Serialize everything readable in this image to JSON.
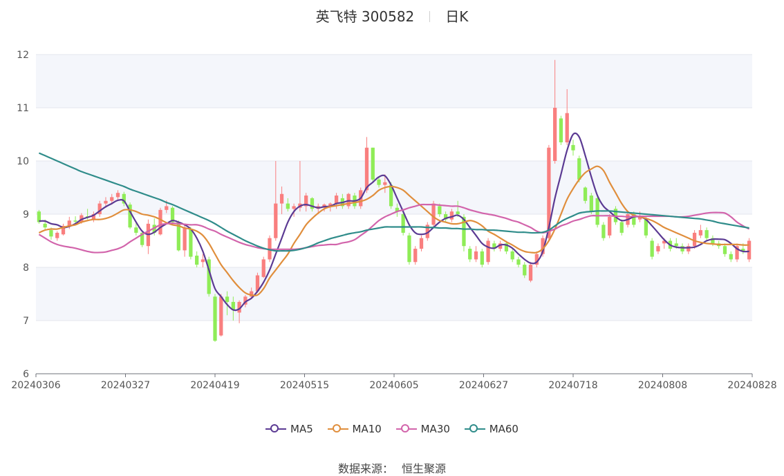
{
  "header": {
    "stock_label": "英飞特 300582",
    "period_label": "日K"
  },
  "legend": {
    "items": [
      {
        "label": "MA5",
        "color": "#5b3a93"
      },
      {
        "label": "MA10",
        "color": "#e08e3c"
      },
      {
        "label": "MA30",
        "color": "#d264ab"
      },
      {
        "label": "MA60",
        "color": "#2f8c8a"
      }
    ]
  },
  "footer": {
    "source_label": "数据来源：",
    "source_value": "恒生聚源"
  },
  "chart_data": {
    "type": "candlestick",
    "ylim": [
      6,
      12
    ],
    "y_ticks": [
      "6",
      "7",
      "8",
      "9",
      "10",
      "11",
      "12"
    ],
    "x_tick_labels": [
      "20240306",
      "20240327",
      "20240419",
      "20240515",
      "20240605",
      "20240627",
      "20240718",
      "20240808",
      "20240828"
    ],
    "up_color": "#f97f7f",
    "down_color": "#8fec57",
    "grid": "horizontal",
    "bands": true,
    "ohlc": [
      [
        9.05,
        9.08,
        8.82,
        8.85
      ],
      [
        8.82,
        8.9,
        8.7,
        8.75
      ],
      [
        8.7,
        8.75,
        8.52,
        8.58
      ],
      [
        8.55,
        8.68,
        8.5,
        8.65
      ],
      [
        8.62,
        8.82,
        8.6,
        8.78
      ],
      [
        8.78,
        8.95,
        8.72,
        8.88
      ],
      [
        8.88,
        8.96,
        8.8,
        8.86
      ],
      [
        8.85,
        9.02,
        8.82,
        8.98
      ],
      [
        8.96,
        9.1,
        8.9,
        8.93
      ],
      [
        8.9,
        9.05,
        8.85,
        9.0
      ],
      [
        9.0,
        9.25,
        8.95,
        9.2
      ],
      [
        9.2,
        9.32,
        9.12,
        9.25
      ],
      [
        9.25,
        9.38,
        9.18,
        9.32
      ],
      [
        9.32,
        9.45,
        9.26,
        9.4
      ],
      [
        9.38,
        9.42,
        9.15,
        9.2
      ],
      [
        9.18,
        9.22,
        8.72,
        8.75
      ],
      [
        8.75,
        8.85,
        8.6,
        8.65
      ],
      [
        8.65,
        8.7,
        8.38,
        8.42
      ],
      [
        8.4,
        8.9,
        8.25,
        8.82
      ],
      [
        8.8,
        8.92,
        8.6,
        8.65
      ],
      [
        8.62,
        9.12,
        8.6,
        9.08
      ],
      [
        9.08,
        9.26,
        9.02,
        9.15
      ],
      [
        9.12,
        9.15,
        8.8,
        8.85
      ],
      [
        8.85,
        8.88,
        8.3,
        8.32
      ],
      [
        8.32,
        8.8,
        8.2,
        8.75
      ],
      [
        8.72,
        8.76,
        8.15,
        8.2
      ],
      [
        8.22,
        8.3,
        8.0,
        8.05
      ],
      [
        8.1,
        8.25,
        8.0,
        8.15
      ],
      [
        8.15,
        8.2,
        7.45,
        7.5
      ],
      [
        7.45,
        7.5,
        6.6,
        6.62
      ],
      [
        6.72,
        7.5,
        6.7,
        7.45
      ],
      [
        7.45,
        7.55,
        7.1,
        7.35
      ],
      [
        7.35,
        7.45,
        7.0,
        7.2
      ],
      [
        7.15,
        7.38,
        6.95,
        7.35
      ],
      [
        7.3,
        7.48,
        7.25,
        7.45
      ],
      [
        7.45,
        7.62,
        7.4,
        7.55
      ],
      [
        7.55,
        7.9,
        7.52,
        7.85
      ],
      [
        7.82,
        8.2,
        7.8,
        8.15
      ],
      [
        8.15,
        8.6,
        8.1,
        8.55
      ],
      [
        8.55,
        10.0,
        8.5,
        9.2
      ],
      [
        9.2,
        9.52,
        9.0,
        9.38
      ],
      [
        9.2,
        9.3,
        9.05,
        9.1
      ],
      [
        9.1,
        9.2,
        8.95,
        9.15
      ],
      [
        9.12,
        10.0,
        9.05,
        9.2
      ],
      [
        9.15,
        9.4,
        9.05,
        9.35
      ],
      [
        9.3,
        9.32,
        9.05,
        9.1
      ],
      [
        9.1,
        9.2,
        9.0,
        9.15
      ],
      [
        9.12,
        9.2,
        9.05,
        9.18
      ],
      [
        9.15,
        9.22,
        9.05,
        9.2
      ],
      [
        9.2,
        9.4,
        9.1,
        9.35
      ],
      [
        9.3,
        9.38,
        9.1,
        9.15
      ],
      [
        9.15,
        9.4,
        9.1,
        9.38
      ],
      [
        9.35,
        9.4,
        9.1,
        9.15
      ],
      [
        9.15,
        9.5,
        9.1,
        9.45
      ],
      [
        9.45,
        10.45,
        9.4,
        10.25
      ],
      [
        10.25,
        10.25,
        9.6,
        9.65
      ],
      [
        9.65,
        9.7,
        9.5,
        9.55
      ],
      [
        9.55,
        9.75,
        9.4,
        9.6
      ],
      [
        9.55,
        9.6,
        9.1,
        9.15
      ],
      [
        9.12,
        9.2,
        8.95,
        9.05
      ],
      [
        9.0,
        9.05,
        8.6,
        8.65
      ],
      [
        8.6,
        8.65,
        8.05,
        8.1
      ],
      [
        8.1,
        8.4,
        8.05,
        8.35
      ],
      [
        8.35,
        8.6,
        8.3,
        8.55
      ],
      [
        8.55,
        8.85,
        8.5,
        8.8
      ],
      [
        8.8,
        9.25,
        8.75,
        9.2
      ],
      [
        9.15,
        9.2,
        8.95,
        9.0
      ],
      [
        9.0,
        9.05,
        8.85,
        8.9
      ],
      [
        8.9,
        9.1,
        8.85,
        9.05
      ],
      [
        9.05,
        9.25,
        8.95,
        9.0
      ],
      [
        8.95,
        9.0,
        8.3,
        8.4
      ],
      [
        8.35,
        8.4,
        8.1,
        8.15
      ],
      [
        8.15,
        8.4,
        8.1,
        8.3
      ],
      [
        8.3,
        8.35,
        8.0,
        8.05
      ],
      [
        8.1,
        8.55,
        8.05,
        8.5
      ],
      [
        8.45,
        8.5,
        8.3,
        8.35
      ],
      [
        8.35,
        8.5,
        8.3,
        8.45
      ],
      [
        8.45,
        8.5,
        8.25,
        8.3
      ],
      [
        8.3,
        8.35,
        8.1,
        8.15
      ],
      [
        8.15,
        8.2,
        8.0,
        8.05
      ],
      [
        8.05,
        8.1,
        7.8,
        7.85
      ],
      [
        7.75,
        8.1,
        7.72,
        8.05
      ],
      [
        8.05,
        8.3,
        8.0,
        8.25
      ],
      [
        8.25,
        8.6,
        8.2,
        8.55
      ],
      [
        8.55,
        10.3,
        8.5,
        10.25
      ],
      [
        10.0,
        11.9,
        9.95,
        11.0
      ],
      [
        10.8,
        10.85,
        10.3,
        10.35
      ],
      [
        10.35,
        11.35,
        10.3,
        10.9
      ],
      [
        10.3,
        10.4,
        10.1,
        10.2
      ],
      [
        10.05,
        10.1,
        9.6,
        9.65
      ],
      [
        9.5,
        9.52,
        9.2,
        9.25
      ],
      [
        9.35,
        9.4,
        9.0,
        9.05
      ],
      [
        9.3,
        9.35,
        8.75,
        8.8
      ],
      [
        8.8,
        8.85,
        8.5,
        8.55
      ],
      [
        8.6,
        9.0,
        8.55,
        8.95
      ],
      [
        9.1,
        9.15,
        8.8,
        8.85
      ],
      [
        8.85,
        8.9,
        8.6,
        8.65
      ],
      [
        8.8,
        9.05,
        8.75,
        9.0
      ],
      [
        9.0,
        9.05,
        8.75,
        8.8
      ],
      [
        8.9,
        9.05,
        8.85,
        8.95
      ],
      [
        8.9,
        8.95,
        8.55,
        8.6
      ],
      [
        8.5,
        8.55,
        8.15,
        8.2
      ],
      [
        8.3,
        8.45,
        8.25,
        8.4
      ],
      [
        8.45,
        8.55,
        8.35,
        8.5
      ],
      [
        8.5,
        8.55,
        8.3,
        8.35
      ],
      [
        8.45,
        8.55,
        8.35,
        8.4
      ],
      [
        8.4,
        8.45,
        8.25,
        8.3
      ],
      [
        8.3,
        8.45,
        8.25,
        8.4
      ],
      [
        8.4,
        8.7,
        8.35,
        8.65
      ],
      [
        8.6,
        8.8,
        8.55,
        8.7
      ],
      [
        8.7,
        8.75,
        8.5,
        8.55
      ],
      [
        8.55,
        8.6,
        8.4,
        8.45
      ],
      [
        8.45,
        8.5,
        8.35,
        8.4
      ],
      [
        8.4,
        8.45,
        8.2,
        8.25
      ],
      [
        8.25,
        8.3,
        8.1,
        8.15
      ],
      [
        8.15,
        8.45,
        8.1,
        8.4
      ],
      [
        8.35,
        8.45,
        8.25,
        8.3
      ],
      [
        8.15,
        8.55,
        8.1,
        8.5
      ]
    ],
    "series": [
      {
        "name": "MA5",
        "color": "#5b3a93",
        "values": [
          8.87,
          8.87,
          8.82,
          8.8,
          8.75,
          8.77,
          8.82,
          8.9,
          8.94,
          8.98,
          9.06,
          9.14,
          9.2,
          9.26,
          9.25,
          9.05,
          8.85,
          8.68,
          8.62,
          8.66,
          8.75,
          8.82,
          8.88,
          8.85,
          8.8,
          8.72,
          8.55,
          8.3,
          7.95,
          7.6,
          7.45,
          7.3,
          7.2,
          7.22,
          7.35,
          7.42,
          7.55,
          7.72,
          7.95,
          8.25,
          8.55,
          8.85,
          9.05,
          9.15,
          9.18,
          9.15,
          9.12,
          9.14,
          9.15,
          9.2,
          9.22,
          9.25,
          9.25,
          9.3,
          9.5,
          9.6,
          9.7,
          9.72,
          9.55,
          9.3,
          9.05,
          8.8,
          8.65,
          8.62,
          8.65,
          8.75,
          8.85,
          8.92,
          8.95,
          8.98,
          8.9,
          8.75,
          8.6,
          8.45,
          8.38,
          8.36,
          8.42,
          8.42,
          8.36,
          8.25,
          8.15,
          8.08,
          8.1,
          8.3,
          8.75,
          9.3,
          9.75,
          10.2,
          10.5,
          10.45,
          10.1,
          9.7,
          9.35,
          9.15,
          9.05,
          8.95,
          8.88,
          8.9,
          8.95,
          8.95,
          8.9,
          8.78,
          8.65,
          8.52,
          8.42,
          8.38,
          8.37,
          8.37,
          8.38,
          8.43,
          8.5,
          8.53,
          8.53,
          8.52,
          8.45,
          8.35,
          8.3,
          8.3
        ]
      },
      {
        "name": "MA10",
        "color": "#e08e3c",
        "values": [
          8.65,
          8.7,
          8.72,
          8.72,
          8.75,
          8.78,
          8.8,
          8.85,
          8.88,
          8.9,
          8.9,
          8.92,
          8.96,
          9.02,
          9.08,
          9.08,
          9.05,
          9.0,
          8.98,
          8.95,
          8.9,
          8.84,
          8.8,
          8.78,
          8.74,
          8.72,
          8.68,
          8.6,
          8.45,
          8.25,
          8.05,
          7.9,
          7.75,
          7.62,
          7.52,
          7.48,
          7.48,
          7.6,
          7.8,
          7.95,
          8.1,
          8.25,
          8.45,
          8.62,
          8.8,
          8.92,
          9.02,
          9.1,
          9.14,
          9.16,
          9.18,
          9.2,
          9.22,
          9.24,
          9.28,
          9.35,
          9.45,
          9.5,
          9.52,
          9.5,
          9.45,
          9.35,
          9.25,
          9.15,
          9.05,
          8.95,
          8.88,
          8.85,
          8.82,
          8.82,
          8.85,
          8.88,
          8.85,
          8.78,
          8.68,
          8.62,
          8.55,
          8.48,
          8.42,
          8.35,
          8.3,
          8.28,
          8.28,
          8.35,
          8.5,
          8.72,
          9.0,
          9.28,
          9.48,
          9.65,
          9.78,
          9.85,
          9.9,
          9.82,
          9.6,
          9.4,
          9.2,
          9.05,
          8.98,
          8.95,
          8.92,
          8.88,
          8.82,
          8.75,
          8.7,
          8.65,
          8.6,
          8.55,
          8.5,
          8.47,
          8.45,
          8.44,
          8.43,
          8.43,
          8.43,
          8.43,
          8.42,
          8.42
        ]
      },
      {
        "name": "MA30",
        "color": "#d264ab",
        "values": [
          8.62,
          8.55,
          8.48,
          8.43,
          8.4,
          8.38,
          8.36,
          8.33,
          8.3,
          8.28,
          8.28,
          8.29,
          8.32,
          8.35,
          8.4,
          8.48,
          8.55,
          8.62,
          8.68,
          8.74,
          8.8,
          8.82,
          8.83,
          8.82,
          8.81,
          8.8,
          8.8,
          8.77,
          8.72,
          8.68,
          8.62,
          8.57,
          8.52,
          8.47,
          8.43,
          8.4,
          8.37,
          8.35,
          8.34,
          8.34,
          8.34,
          8.34,
          8.34,
          8.35,
          8.37,
          8.39,
          8.41,
          8.42,
          8.43,
          8.43,
          8.46,
          8.48,
          8.52,
          8.6,
          8.68,
          8.78,
          8.88,
          8.95,
          9.0,
          9.05,
          9.08,
          9.12,
          9.15,
          9.18,
          9.18,
          9.18,
          9.17,
          9.16,
          9.15,
          9.15,
          9.12,
          9.08,
          9.05,
          9.02,
          9.0,
          8.98,
          8.95,
          8.92,
          8.88,
          8.85,
          8.8,
          8.75,
          8.68,
          8.65,
          8.68,
          8.72,
          8.78,
          8.82,
          8.87,
          8.9,
          8.94,
          8.97,
          8.97,
          8.97,
          8.97,
          8.96,
          8.96,
          8.95,
          8.96,
          8.96,
          8.96,
          8.96,
          8.96,
          8.96,
          8.96,
          8.95,
          8.95,
          8.96,
          8.98,
          9.0,
          9.02,
          9.03,
          9.03,
          9.02,
          8.95,
          8.85,
          8.78,
          8.72
        ]
      },
      {
        "name": "MA60",
        "color": "#2f8c8a",
        "values": [
          10.15,
          10.1,
          10.05,
          10.0,
          9.95,
          9.9,
          9.85,
          9.8,
          9.76,
          9.72,
          9.68,
          9.64,
          9.6,
          9.56,
          9.52,
          9.47,
          9.43,
          9.39,
          9.35,
          9.31,
          9.27,
          9.22,
          9.18,
          9.13,
          9.08,
          9.03,
          8.98,
          8.93,
          8.88,
          8.82,
          8.75,
          8.68,
          8.62,
          8.56,
          8.5,
          8.45,
          8.4,
          8.36,
          8.33,
          8.31,
          8.31,
          8.31,
          8.32,
          8.34,
          8.37,
          8.41,
          8.46,
          8.5,
          8.54,
          8.57,
          8.6,
          8.63,
          8.65,
          8.67,
          8.7,
          8.72,
          8.74,
          8.76,
          8.76,
          8.76,
          8.76,
          8.76,
          8.76,
          8.76,
          8.75,
          8.75,
          8.74,
          8.74,
          8.73,
          8.73,
          8.72,
          8.72,
          8.71,
          8.71,
          8.7,
          8.7,
          8.69,
          8.68,
          8.67,
          8.66,
          8.66,
          8.65,
          8.65,
          8.66,
          8.7,
          8.78,
          8.86,
          8.92,
          8.97,
          9.02,
          9.04,
          9.05,
          9.06,
          9.06,
          9.06,
          9.05,
          9.04,
          9.03,
          9.02,
          9.01,
          9.0,
          8.99,
          8.98,
          8.97,
          8.96,
          8.95,
          8.94,
          8.93,
          8.92,
          8.91,
          8.89,
          8.87,
          8.84,
          8.82,
          8.8,
          8.78,
          8.76,
          8.74
        ]
      }
    ]
  }
}
